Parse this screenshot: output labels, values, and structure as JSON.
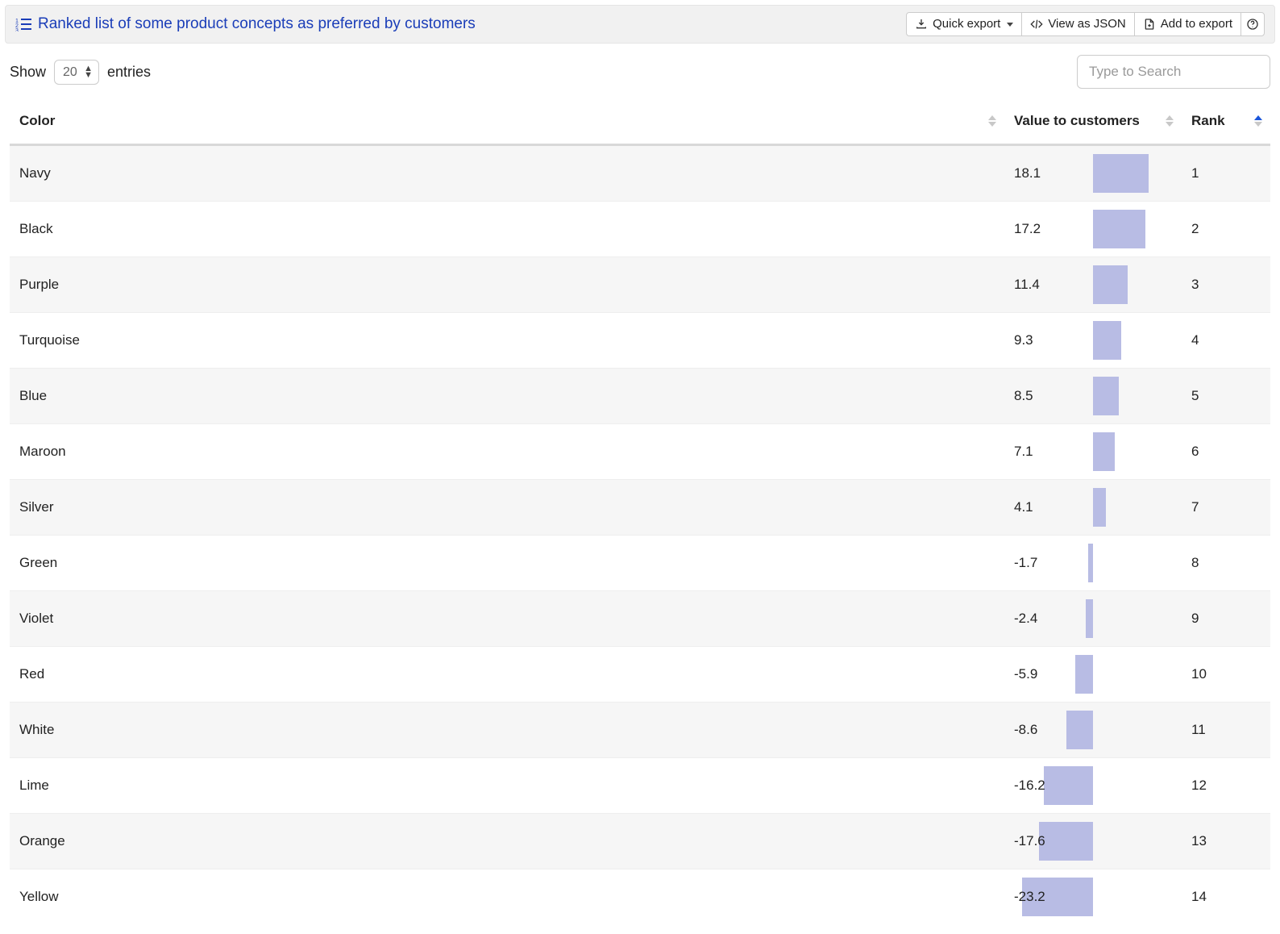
{
  "header": {
    "title": "Ranked list of some product concepts as preferred by customers",
    "buttons": {
      "quick_export": "Quick export",
      "view_json": "View as JSON",
      "add_export": "Add to export"
    }
  },
  "controls": {
    "show_label_pre": "Show",
    "show_label_post": "entries",
    "entries_value": "20",
    "search_placeholder": "Type to Search"
  },
  "columns": {
    "color": "Color",
    "value": "Value to customers",
    "rank": "Rank"
  },
  "sort": {
    "column": "rank",
    "dir": "asc"
  },
  "value_axis": {
    "min": -23.2,
    "max": 18.1,
    "zero_frac": 0.5,
    "scale_frac": 0.4
  },
  "rows": [
    {
      "color": "Navy",
      "value": 18.1,
      "rank": 1
    },
    {
      "color": "Black",
      "value": 17.2,
      "rank": 2
    },
    {
      "color": "Purple",
      "value": 11.4,
      "rank": 3
    },
    {
      "color": "Turquoise",
      "value": 9.3,
      "rank": 4
    },
    {
      "color": "Blue",
      "value": 8.5,
      "rank": 5
    },
    {
      "color": "Maroon",
      "value": 7.1,
      "rank": 6
    },
    {
      "color": "Silver",
      "value": 4.1,
      "rank": 7
    },
    {
      "color": "Green",
      "value": -1.7,
      "rank": 8
    },
    {
      "color": "Violet",
      "value": -2.4,
      "rank": 9
    },
    {
      "color": "Red",
      "value": -5.9,
      "rank": 10
    },
    {
      "color": "White",
      "value": -8.6,
      "rank": 11
    },
    {
      "color": "Lime",
      "value": -16.2,
      "rank": 12
    },
    {
      "color": "Orange",
      "value": -17.6,
      "rank": 13
    },
    {
      "color": "Yellow",
      "value": -23.2,
      "rank": 14
    }
  ],
  "chart_data": {
    "type": "bar",
    "title": "Value to customers",
    "categories": [
      "Navy",
      "Black",
      "Purple",
      "Turquoise",
      "Blue",
      "Maroon",
      "Silver",
      "Green",
      "Violet",
      "Red",
      "White",
      "Lime",
      "Orange",
      "Yellow"
    ],
    "values": [
      18.1,
      17.2,
      11.4,
      9.3,
      8.5,
      7.1,
      4.1,
      -1.7,
      -2.4,
      -5.9,
      -8.6,
      -16.2,
      -17.6,
      -23.2
    ],
    "xlabel": "",
    "ylabel": "",
    "ylim": [
      -23.2,
      18.1
    ]
  }
}
